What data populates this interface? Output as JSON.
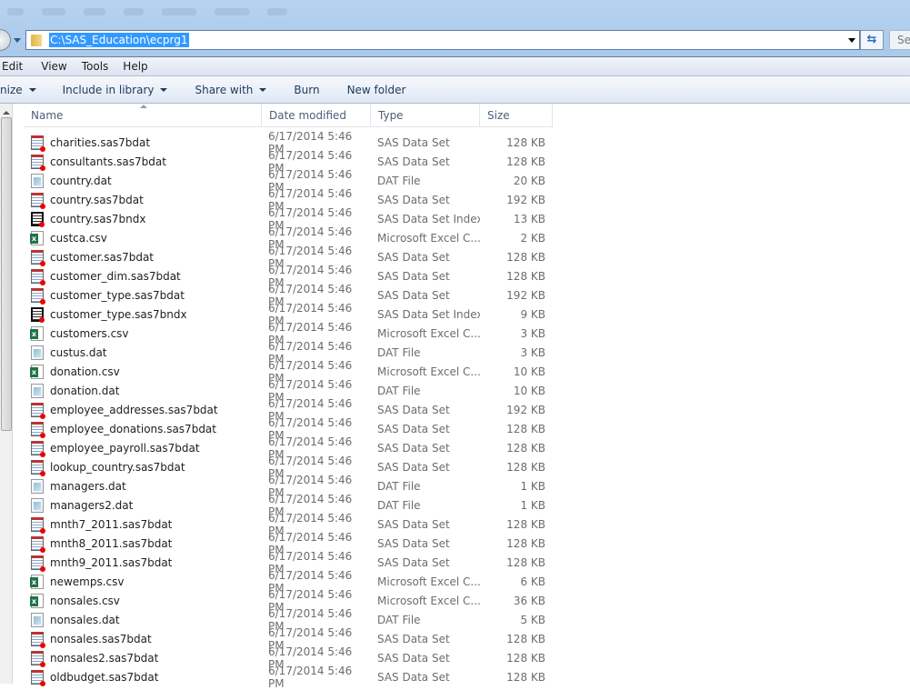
{
  "address": {
    "path": "C:\\SAS_Education\\ecprg1",
    "search_placeholder": "Se"
  },
  "menu": [
    "Edit",
    "View",
    "Tools",
    "Help"
  ],
  "toolbar": {
    "organize": "nize",
    "include": "Include in library",
    "share": "Share with",
    "burn": "Burn",
    "new_folder": "New folder"
  },
  "columns": {
    "name": "Name",
    "date": "Date modified",
    "type": "Type",
    "size": "Size"
  },
  "files": [
    {
      "name": "charities.sas7bdat",
      "date": "6/17/2014 5:46 PM",
      "type": "SAS Data Set",
      "size": "128 KB",
      "icon": "sas"
    },
    {
      "name": "consultants.sas7bdat",
      "date": "6/17/2014 5:46 PM",
      "type": "SAS Data Set",
      "size": "128 KB",
      "icon": "sas"
    },
    {
      "name": "country.dat",
      "date": "6/17/2014 5:46 PM",
      "type": "DAT File",
      "size": "20 KB",
      "icon": "dat"
    },
    {
      "name": "country.sas7bdat",
      "date": "6/17/2014 5:46 PM",
      "type": "SAS Data Set",
      "size": "192 KB",
      "icon": "sas"
    },
    {
      "name": "country.sas7bndx",
      "date": "6/17/2014 5:46 PM",
      "type": "SAS Data Set Index",
      "size": "13 KB",
      "icon": "idx"
    },
    {
      "name": "custca.csv",
      "date": "6/17/2014 5:46 PM",
      "type": "Microsoft Excel C...",
      "size": "2 KB",
      "icon": "csv"
    },
    {
      "name": "customer.sas7bdat",
      "date": "6/17/2014 5:46 PM",
      "type": "SAS Data Set",
      "size": "128 KB",
      "icon": "sas"
    },
    {
      "name": "customer_dim.sas7bdat",
      "date": "6/17/2014 5:46 PM",
      "type": "SAS Data Set",
      "size": "128 KB",
      "icon": "sas"
    },
    {
      "name": "customer_type.sas7bdat",
      "date": "6/17/2014 5:46 PM",
      "type": "SAS Data Set",
      "size": "192 KB",
      "icon": "sas"
    },
    {
      "name": "customer_type.sas7bndx",
      "date": "6/17/2014 5:46 PM",
      "type": "SAS Data Set Index",
      "size": "9 KB",
      "icon": "idx"
    },
    {
      "name": "customers.csv",
      "date": "6/17/2014 5:46 PM",
      "type": "Microsoft Excel C...",
      "size": "3 KB",
      "icon": "csv"
    },
    {
      "name": "custus.dat",
      "date": "6/17/2014 5:46 PM",
      "type": "DAT File",
      "size": "3 KB",
      "icon": "dat"
    },
    {
      "name": "donation.csv",
      "date": "6/17/2014 5:46 PM",
      "type": "Microsoft Excel C...",
      "size": "10 KB",
      "icon": "csv"
    },
    {
      "name": "donation.dat",
      "date": "6/17/2014 5:46 PM",
      "type": "DAT File",
      "size": "10 KB",
      "icon": "dat"
    },
    {
      "name": "employee_addresses.sas7bdat",
      "date": "6/17/2014 5:46 PM",
      "type": "SAS Data Set",
      "size": "192 KB",
      "icon": "sas"
    },
    {
      "name": "employee_donations.sas7bdat",
      "date": "6/17/2014 5:46 PM",
      "type": "SAS Data Set",
      "size": "128 KB",
      "icon": "sas"
    },
    {
      "name": "employee_payroll.sas7bdat",
      "date": "6/17/2014 5:46 PM",
      "type": "SAS Data Set",
      "size": "128 KB",
      "icon": "sas"
    },
    {
      "name": "lookup_country.sas7bdat",
      "date": "6/17/2014 5:46 PM",
      "type": "SAS Data Set",
      "size": "128 KB",
      "icon": "sas"
    },
    {
      "name": "managers.dat",
      "date": "6/17/2014 5:46 PM",
      "type": "DAT File",
      "size": "1 KB",
      "icon": "dat"
    },
    {
      "name": "managers2.dat",
      "date": "6/17/2014 5:46 PM",
      "type": "DAT File",
      "size": "1 KB",
      "icon": "dat"
    },
    {
      "name": "mnth7_2011.sas7bdat",
      "date": "6/17/2014 5:46 PM",
      "type": "SAS Data Set",
      "size": "128 KB",
      "icon": "sas"
    },
    {
      "name": "mnth8_2011.sas7bdat",
      "date": "6/17/2014 5:46 PM",
      "type": "SAS Data Set",
      "size": "128 KB",
      "icon": "sas"
    },
    {
      "name": "mnth9_2011.sas7bdat",
      "date": "6/17/2014 5:46 PM",
      "type": "SAS Data Set",
      "size": "128 KB",
      "icon": "sas"
    },
    {
      "name": "newemps.csv",
      "date": "6/17/2014 5:46 PM",
      "type": "Microsoft Excel C...",
      "size": "6 KB",
      "icon": "csv"
    },
    {
      "name": "nonsales.csv",
      "date": "6/17/2014 5:46 PM",
      "type": "Microsoft Excel C...",
      "size": "36 KB",
      "icon": "csv"
    },
    {
      "name": "nonsales.dat",
      "date": "6/17/2014 5:46 PM",
      "type": "DAT File",
      "size": "5 KB",
      "icon": "dat"
    },
    {
      "name": "nonsales.sas7bdat",
      "date": "6/17/2014 5:46 PM",
      "type": "SAS Data Set",
      "size": "128 KB",
      "icon": "sas"
    },
    {
      "name": "nonsales2.sas7bdat",
      "date": "6/17/2014 5:46 PM",
      "type": "SAS Data Set",
      "size": "128 KB",
      "icon": "sas"
    },
    {
      "name": "oldbudget.sas7bdat",
      "date": "6/17/2014 5:46 PM",
      "type": "SAS Data Set",
      "size": "128 KB",
      "icon": "sas"
    }
  ]
}
